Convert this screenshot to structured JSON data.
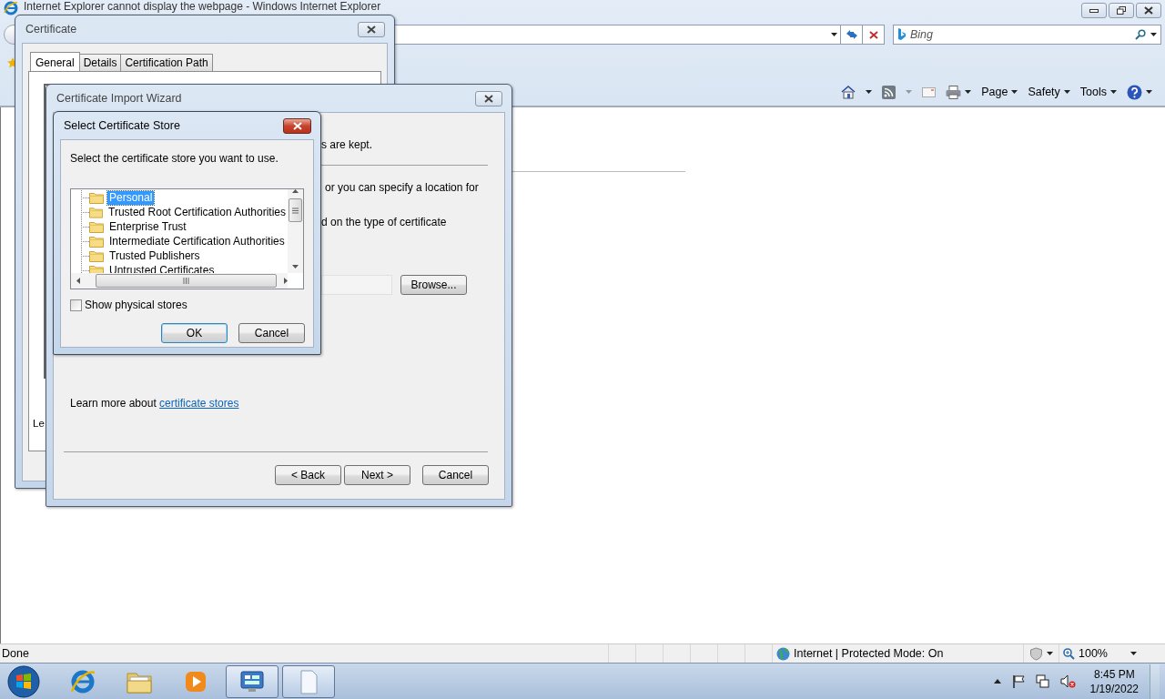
{
  "browser": {
    "title": "Internet Explorer cannot display the webpage - Windows Internet Explorer",
    "search": {
      "placeholder": "Bing"
    },
    "command_bar": [
      {
        "label": "Page"
      },
      {
        "label": "Safety"
      },
      {
        "label": "Tools"
      }
    ],
    "status_bar": {
      "text": "Done",
      "zone": "Internet | Protected Mode: On",
      "zoom": "100%"
    }
  },
  "certificate_dialog": {
    "title": "Certificate",
    "tabs": [
      {
        "label": "General",
        "selected": true
      },
      {
        "label": "Details",
        "selected": false
      },
      {
        "label": "Certification Path",
        "selected": false
      }
    ],
    "partial_text": "Le"
  },
  "import_wizard": {
    "title": "Certificate Import Wizard",
    "texts": [
      "s are kept.",
      "or you can specify a location for",
      "d on the type of certificate"
    ],
    "browse_button": "Browse...",
    "learn_more": {
      "text": "Learn more about ",
      "link": "certificate stores"
    },
    "buttons": [
      "< Back",
      "Next >",
      "Cancel"
    ]
  },
  "store_dialog": {
    "title": "Select Certificate Store",
    "prompt": "Select the certificate store you want to use.",
    "stores": [
      {
        "label": "Personal",
        "selected": true
      },
      {
        "label": "Trusted Root Certification Authorities",
        "selected": false
      },
      {
        "label": "Enterprise Trust",
        "selected": false
      },
      {
        "label": "Intermediate Certification Authorities",
        "selected": false
      },
      {
        "label": "Trusted Publishers",
        "selected": false
      },
      {
        "label": "Untrusted Certificates",
        "selected": false
      }
    ],
    "show_physical": {
      "label": "Show physical stores",
      "checked": false
    },
    "buttons": [
      "OK",
      "Cancel"
    ]
  },
  "taskbar": {
    "apps": [
      {
        "kind": "browser",
        "selected": false
      },
      {
        "kind": "folder",
        "selected": false
      },
      {
        "kind": "media",
        "selected": false
      },
      {
        "kind": "control",
        "selected": true
      },
      {
        "kind": "document",
        "selected": true
      }
    ],
    "time": "8:45 PM",
    "date": "1/19/2022"
  }
}
